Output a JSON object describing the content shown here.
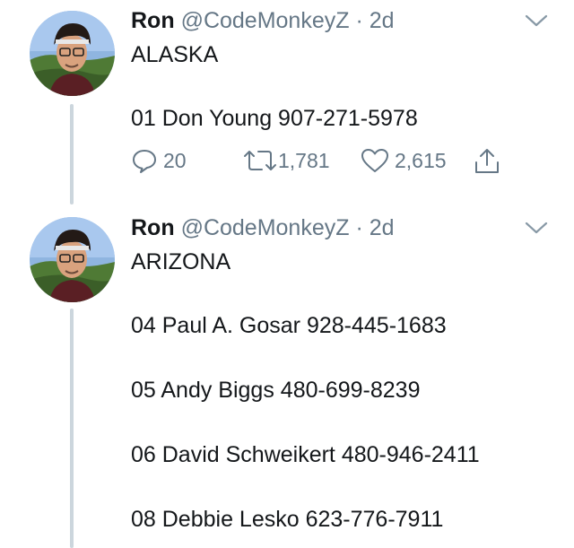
{
  "tweets": [
    {
      "author_name": "Ron",
      "handle": "@CodeMonkeyZ",
      "separator": "·",
      "time": "2d",
      "lines": [
        "ALASKA",
        "01 Don Young 907-271-5978"
      ],
      "stats": {
        "replies": "20",
        "retweets": "1,781",
        "likes": "2,615"
      },
      "icons": {
        "reply": "reply-icon",
        "retweet": "retweet-icon",
        "like": "like-icon",
        "share": "share-icon",
        "menu": "chevron-down-icon"
      }
    },
    {
      "author_name": "Ron",
      "handle": "@CodeMonkeyZ",
      "separator": "·",
      "time": "2d",
      "lines": [
        "ARIZONA",
        "04 Paul A. Gosar 928-445-1683",
        "05 Andy Biggs 480-699-8239",
        "06 David Schweikert 480-946-2411",
        "08 Debbie Lesko 623-776-7911"
      ]
    }
  ],
  "colors": {
    "text": "#14171a",
    "muted": "#657786",
    "thread_line": "#ccd6dd",
    "background": "#ffffff"
  }
}
